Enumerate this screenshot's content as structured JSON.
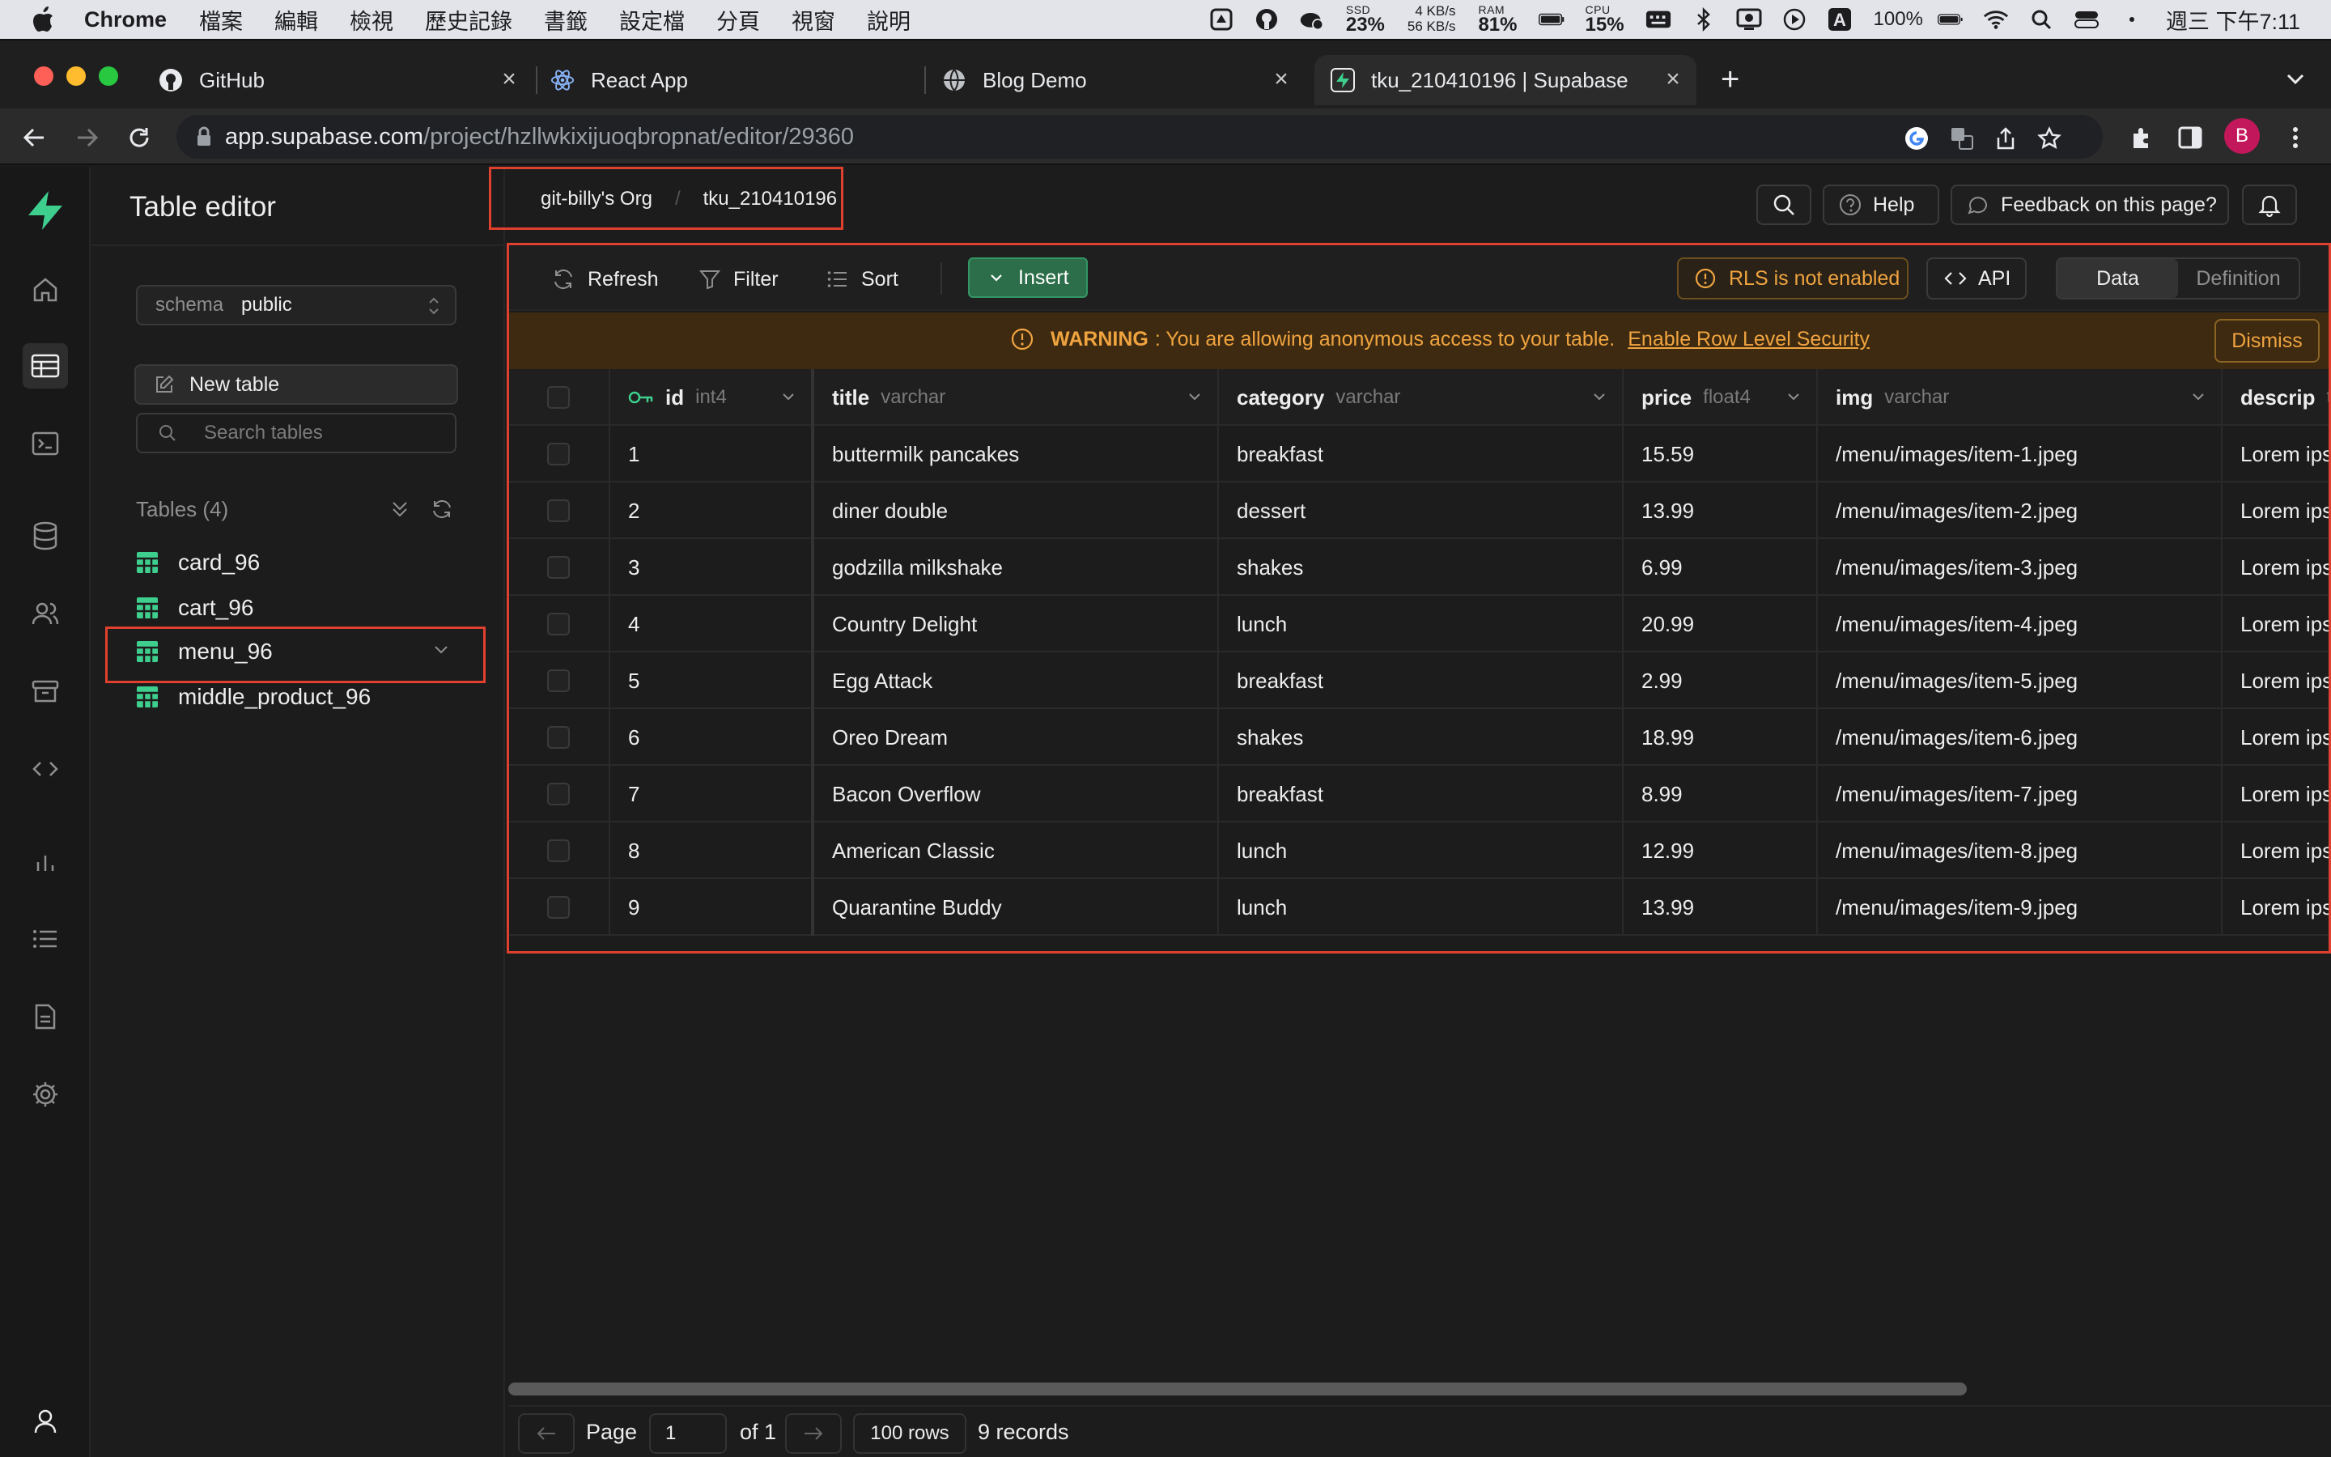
{
  "menubar": {
    "app_name": "Chrome",
    "items": [
      "檔案",
      "編輯",
      "檢視",
      "歷史記錄",
      "書籤",
      "設定檔",
      "分頁",
      "視窗",
      "說明"
    ],
    "ssd_label": "SSD",
    "ssd_value": "23%",
    "net_up": "4 KB/s",
    "net_down": "56 KB/s",
    "ram_label": "RAM",
    "ram_value": "81%",
    "cpu_label": "CPU",
    "cpu_value": "15%",
    "battery_pct": "100%",
    "clock": "週三 下午7:11"
  },
  "browser": {
    "tabs": [
      {
        "title": "GitHub",
        "favicon": "github-icon"
      },
      {
        "title": "React App",
        "favicon": "react-icon"
      },
      {
        "title": "Blog Demo",
        "favicon": "globe-icon"
      },
      {
        "title": "tku_210410196 | Supabase",
        "favicon": "supabase-icon",
        "active": true
      }
    ],
    "url_host": "app.supabase.com",
    "url_path": "/project/hzllwkixijuoqbropnat/editor/29360",
    "profile_initial": "B"
  },
  "sidebar": {
    "title": "Table editor",
    "schema_label": "schema",
    "schema_value": "public",
    "new_table_label": "New table",
    "search_placeholder": "Search tables",
    "tables_header": "Tables (4)",
    "tables": [
      {
        "name": "card_96"
      },
      {
        "name": "cart_96"
      },
      {
        "name": "menu_96",
        "active": true
      },
      {
        "name": "middle_product_96"
      }
    ]
  },
  "header": {
    "breadcrumb_org": "git-billy's Org",
    "breadcrumb_project": "tku_210410196",
    "help_label": "Help",
    "feedback_label": "Feedback on this page?"
  },
  "toolbar": {
    "refresh_label": "Refresh",
    "filter_label": "Filter",
    "sort_label": "Sort",
    "insert_label": "Insert",
    "rls_label": "RLS is not enabled",
    "api_label": "API",
    "view_data": "Data",
    "view_definition": "Definition"
  },
  "warning": {
    "heading": "WARNING",
    "message": ": You are allowing anonymous access to your table.",
    "link": "Enable Row Level Security",
    "dismiss_label": "Dismiss"
  },
  "grid": {
    "columns": [
      {
        "name": "id",
        "type": "int4"
      },
      {
        "name": "title",
        "type": "varchar"
      },
      {
        "name": "category",
        "type": "varchar"
      },
      {
        "name": "price",
        "type": "float4"
      },
      {
        "name": "img",
        "type": "varchar"
      },
      {
        "name": "descrip",
        "type": "tex"
      }
    ],
    "rows": [
      [
        "1",
        "buttermilk pancakes",
        "breakfast",
        "15.59",
        "/menu/images/item-1.jpeg",
        "Lorem ipsu"
      ],
      [
        "2",
        "diner double",
        "dessert",
        "13.99",
        "/menu/images/item-2.jpeg",
        "Lorem ipsu"
      ],
      [
        "3",
        "godzilla milkshake",
        "shakes",
        "6.99",
        "/menu/images/item-3.jpeg",
        "Lorem ipsu"
      ],
      [
        "4",
        "Country Delight",
        "lunch",
        "20.99",
        "/menu/images/item-4.jpeg",
        "Lorem ipsu"
      ],
      [
        "5",
        "Egg Attack",
        "breakfast",
        "2.99",
        "/menu/images/item-5.jpeg",
        "Lorem ipsu"
      ],
      [
        "6",
        "Oreo Dream",
        "shakes",
        "18.99",
        "/menu/images/item-6.jpeg",
        "Lorem ipsu"
      ],
      [
        "7",
        "Bacon Overflow",
        "breakfast",
        "8.99",
        "/menu/images/item-7.jpeg",
        "Lorem ipsu"
      ],
      [
        "8",
        "American Classic",
        "lunch",
        "12.99",
        "/menu/images/item-8.jpeg",
        "Lorem ipsu"
      ],
      [
        "9",
        "Quarantine Buddy",
        "lunch",
        "13.99",
        "/menu/images/item-9.jpeg",
        "Lorem ipsu"
      ]
    ]
  },
  "footer": {
    "page_label": "Page",
    "page_value": "1",
    "of_label": "of 1",
    "rows_label": "100 rows",
    "records_label": "9 records"
  },
  "colors": {
    "accent": "#3ecf8e",
    "warning": "#f0a440",
    "highlight_box": "#e0402e"
  }
}
